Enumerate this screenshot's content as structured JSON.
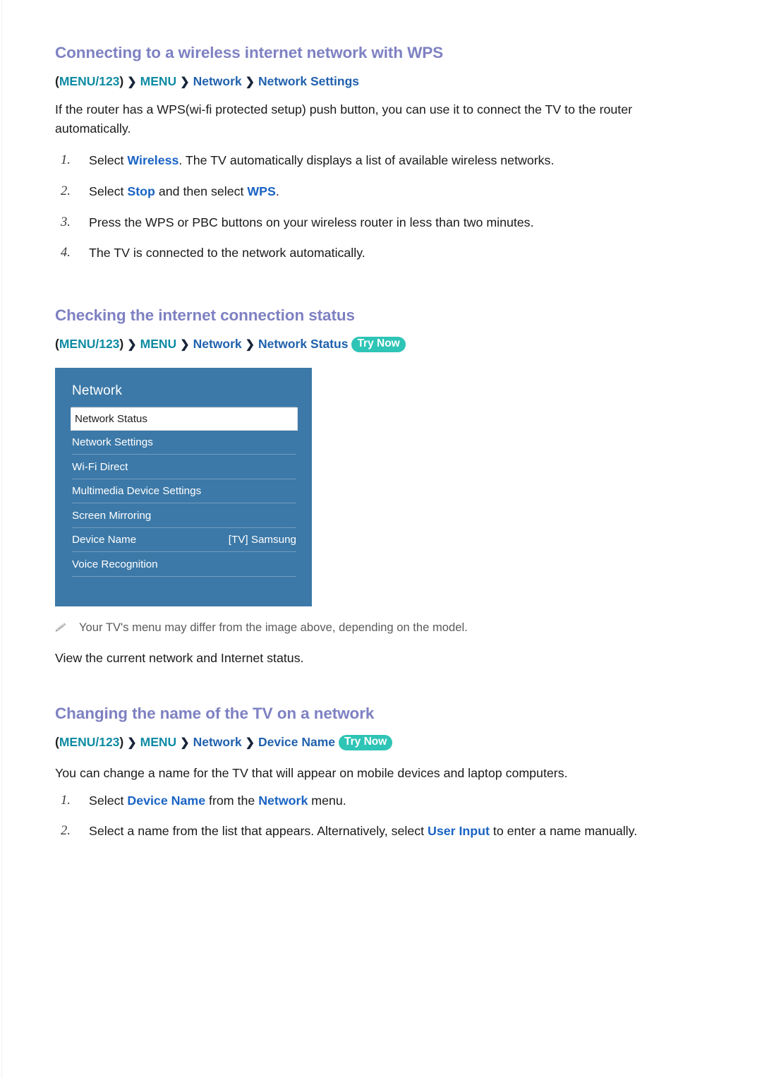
{
  "sections": [
    {
      "id": "wps",
      "title": "Connecting to a wireless internet network with WPS",
      "breadcrumb": {
        "open_paren": "(",
        "menu123": "MENU/123",
        "close_paren": ")",
        "sep": "❯",
        "menu": "MENU",
        "network": "Network",
        "leaf": "Network Settings"
      },
      "intro": "If the router has a WPS(wi-fi protected setup) push button, you can use it to connect the TV to the router automatically.",
      "steps": [
        {
          "num": "1.",
          "pre": "Select ",
          "kw": "Wireless",
          "post": ". The TV automatically displays a list of available wireless networks."
        },
        {
          "num": "2.",
          "pre": "Select ",
          "kw": "Stop",
          "mid": " and then select ",
          "kw2": "WPS",
          "post": "."
        },
        {
          "num": "3.",
          "text": "Press the WPS or PBC buttons on your wireless router in less than two minutes."
        },
        {
          "num": "4.",
          "text": "The TV is connected to the network automatically."
        }
      ]
    },
    {
      "id": "status",
      "title": "Checking the internet connection status",
      "breadcrumb": {
        "open_paren": "(",
        "menu123": "MENU/123",
        "close_paren": ")",
        "sep": "❯",
        "menu": "MENU",
        "network": "Network",
        "leaf": "Network Status",
        "badge": "Try Now"
      },
      "note": "Your TV's menu may differ from the image above, depending on the model.",
      "outro": "View the current network and Internet status."
    },
    {
      "id": "devicename",
      "title": "Changing the name of the TV on a network",
      "breadcrumb": {
        "open_paren": "(",
        "menu123": "MENU/123",
        "close_paren": ")",
        "sep": "❯",
        "menu": "MENU",
        "network": "Network",
        "leaf": "Device Name",
        "badge": "Try Now"
      },
      "intro": "You can change a name for the TV that will appear on mobile devices and laptop computers.",
      "steps": [
        {
          "num": "1.",
          "pre": "Select ",
          "kw": "Device Name",
          "mid": " from the ",
          "kw2": "Network",
          "post": " menu."
        },
        {
          "num": "2.",
          "pre": "Select a name from the list that appears. Alternatively, select ",
          "kw": "User Input",
          "post": " to enter a name manually."
        }
      ]
    }
  ],
  "tv_menu": {
    "title": "Network",
    "items": [
      {
        "label": "Network Status",
        "value": "",
        "selected": true
      },
      {
        "label": "Network Settings",
        "value": "",
        "selected": false
      },
      {
        "label": "Wi-Fi Direct",
        "value": "",
        "selected": false
      },
      {
        "label": "Multimedia Device Settings",
        "value": "",
        "selected": false
      },
      {
        "label": "Screen Mirroring",
        "value": "",
        "selected": false
      },
      {
        "label": "Device Name",
        "value": "[TV] Samsung",
        "selected": false
      },
      {
        "label": "Voice Recognition",
        "value": "",
        "selected": false
      }
    ]
  },
  "colors": {
    "heading": "#7e81c2",
    "breadcrumb_teal": "#0e8ba3",
    "breadcrumb_blue": "#2061ad",
    "keyword_blue": "#1a63c4",
    "badge_bg": "#2ec4b6",
    "tv_menu_bg": "#3c79a8"
  }
}
